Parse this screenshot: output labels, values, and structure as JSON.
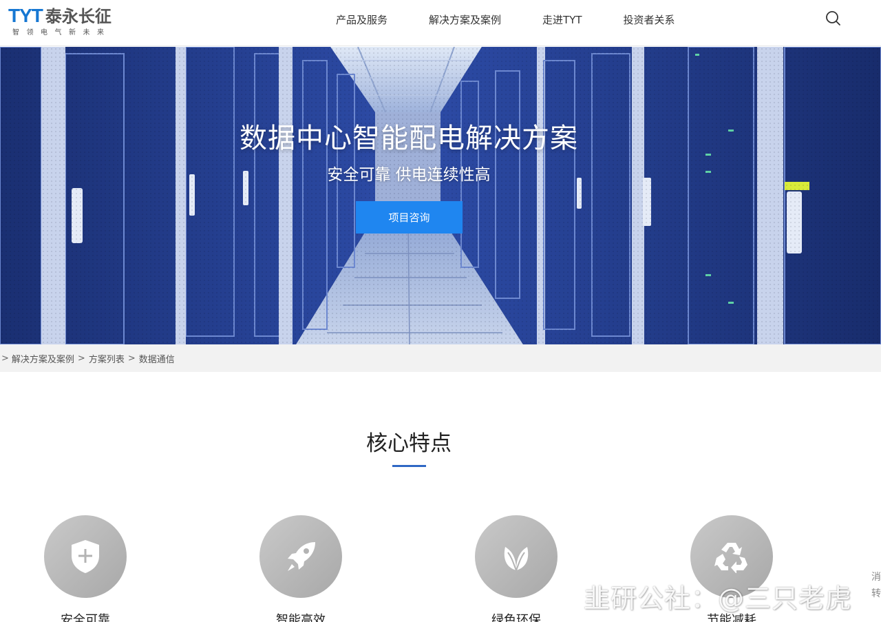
{
  "header": {
    "logo_brand": "TYT",
    "logo_name": "泰永长征",
    "logo_slogan": "智领电气新未来",
    "nav": [
      {
        "label": "产品及服务"
      },
      {
        "label": "解决方案及案例"
      },
      {
        "label": "走进TYT"
      },
      {
        "label": "投资者关系"
      }
    ],
    "search_icon": "search-icon"
  },
  "hero": {
    "title": "数据中心智能配电解决方案",
    "subtitle": "安全可靠 供电连续性高",
    "button_label": "项目咨询",
    "button_color": "#1f86f0"
  },
  "breadcrumb": {
    "separator": ">",
    "items": [
      "解决方案及案例",
      "方案列表",
      "数据通信"
    ]
  },
  "section": {
    "title": "核心特点",
    "accent_color": "#2f67c4",
    "features": [
      {
        "label": "安全可靠",
        "icon": "shield-plus-icon"
      },
      {
        "label": "智能高效",
        "icon": "rocket-icon"
      },
      {
        "label": "绿色环保",
        "icon": "leaf-icon"
      },
      {
        "label": "节能减耗",
        "icon": "recycle-icon"
      }
    ]
  },
  "watermark": "韭研公社：@三只老虎",
  "side_tab": "消转"
}
